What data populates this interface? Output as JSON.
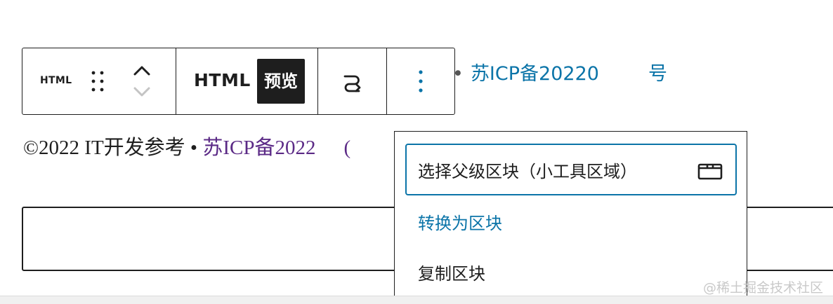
{
  "background_text": {
    "bullet": "•",
    "icp_link": "苏ICP备20220",
    "icp_tail": "号"
  },
  "copyright": {
    "prefix": "©2022 IT开发参考 •",
    "link": "苏ICP备2022",
    "tail": "("
  },
  "toolbar": {
    "block_type": "HTML",
    "html_tab": "HTML",
    "preview_tab": "预览",
    "icons": {
      "drag": "drag-handle-icon",
      "move_up": "chevron-up-icon",
      "move_down": "chevron-down-icon",
      "transform": "transform-arrow-icon",
      "options": "more-vertical-icon"
    }
  },
  "menu": {
    "items": [
      {
        "label": "选择父级区块（小工具区域）",
        "icon": "widget-area-icon"
      },
      {
        "label": "转换为区块"
      },
      {
        "label": "复制区块"
      }
    ]
  },
  "watermark": "@稀土掘金技术社区",
  "colors": {
    "accent": "#0b74a8",
    "visited_link": "#5b2a86",
    "text": "#1e1e1e"
  }
}
